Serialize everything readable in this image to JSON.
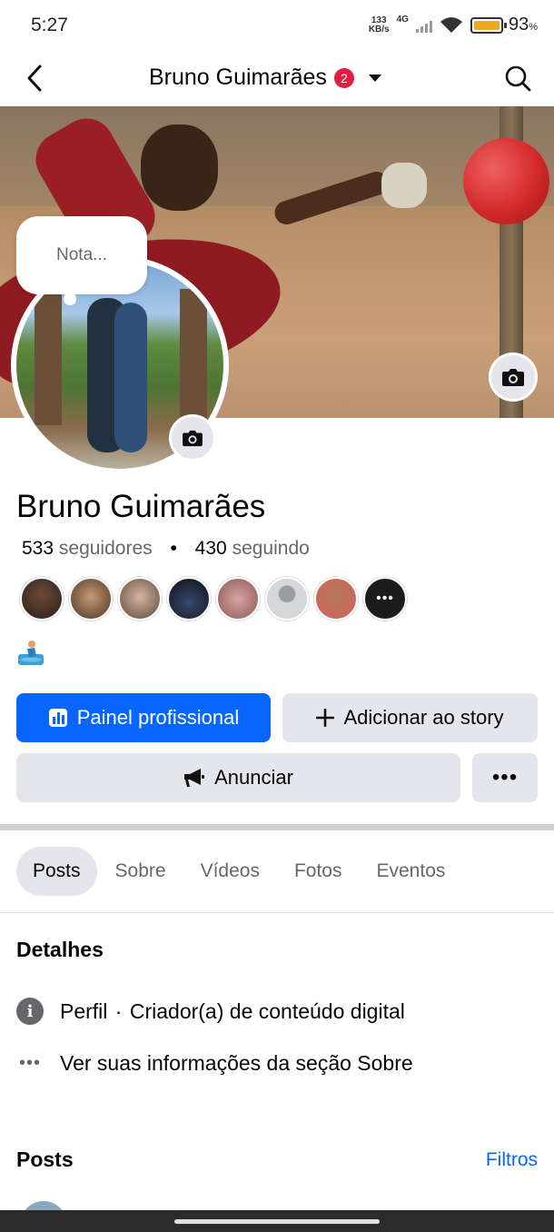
{
  "status_bar": {
    "time": "5:27",
    "speed_value": "133",
    "speed_unit": "KB/s",
    "network": "4G",
    "battery_percent": "93",
    "battery_unit": "%"
  },
  "header": {
    "title": "Bruno Guimarães",
    "notification_count": "2"
  },
  "profile": {
    "note_placeholder": "Nota...",
    "name": "Bruno Guimarães",
    "followers_count": "533",
    "followers_label": "seguidores",
    "following_count": "430",
    "following_label": "seguindo",
    "separator": "•",
    "more_friends": "•••"
  },
  "actions": {
    "professional_dashboard": "Painel profissional",
    "add_to_story": "Adicionar ao story",
    "advertise": "Anunciar",
    "more": "•••"
  },
  "tabs": [
    {
      "label": "Posts",
      "active": true
    },
    {
      "label": "Sobre",
      "active": false
    },
    {
      "label": "Vídeos",
      "active": false
    },
    {
      "label": "Fotos",
      "active": false
    },
    {
      "label": "Eventos",
      "active": false
    }
  ],
  "details": {
    "title": "Detalhes",
    "profile_type_label": "Perfil",
    "profile_type_separator": "·",
    "profile_type_value": "Criador(a) de conteúdo digital",
    "see_about": "Ver suas informações da seção Sobre"
  },
  "posts_section": {
    "title": "Posts",
    "filters": "Filtros"
  },
  "colors": {
    "primary": "#0866ff",
    "secondary_bg": "#e4e6eb",
    "badge": "#e41e3f",
    "secondary_text": "#65676b"
  }
}
